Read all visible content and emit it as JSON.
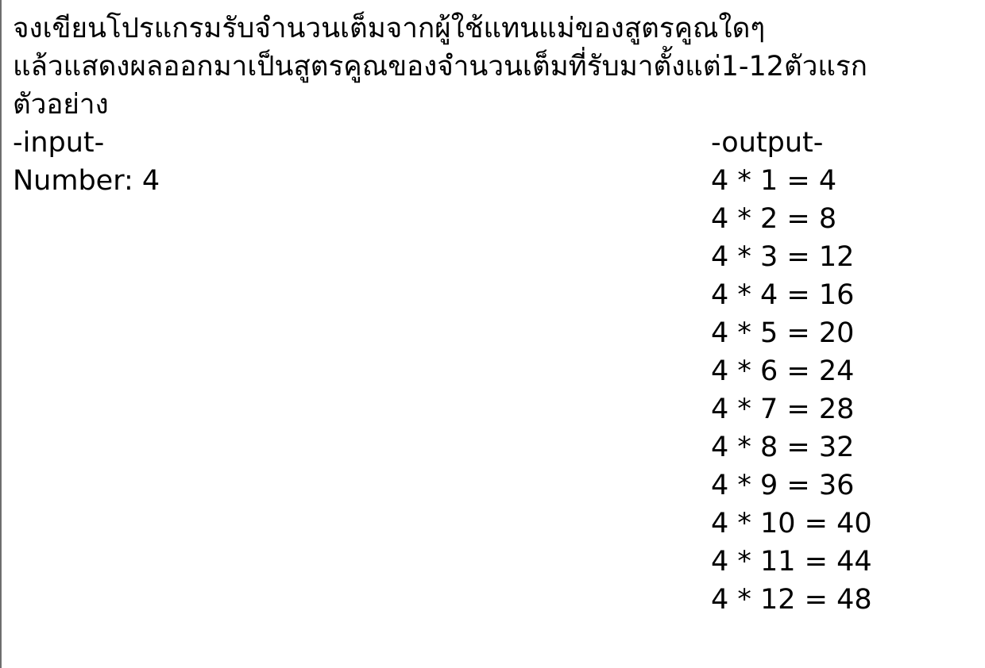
{
  "instructions": [
    "จงเขียนโปรแกรมรับจำนวนเต็มจากผู้ใช้แทนแม่ของสูตรคูณใดๆ",
    "แล้วแสดงผลออกมาเป็นสูตรคูณของจำนวนเต็มที่รับมาตั้งแต่1-12ตัวแรก",
    "ตัวอย่าง"
  ],
  "input": {
    "heading": "-input-",
    "lines": [
      "Number: 4"
    ]
  },
  "output": {
    "heading": "-output-",
    "lines": [
      "4 * 1 = 4",
      "4 * 2 = 8",
      "4 * 3 = 12",
      "4 * 4 = 16",
      "4 * 5 = 20",
      "4 * 6 = 24",
      "4 * 7 = 28",
      "4 * 8 = 32",
      "4 * 9 = 36",
      "4 * 10 = 40",
      "4 * 11 = 44",
      "4 * 12 = 48"
    ]
  }
}
